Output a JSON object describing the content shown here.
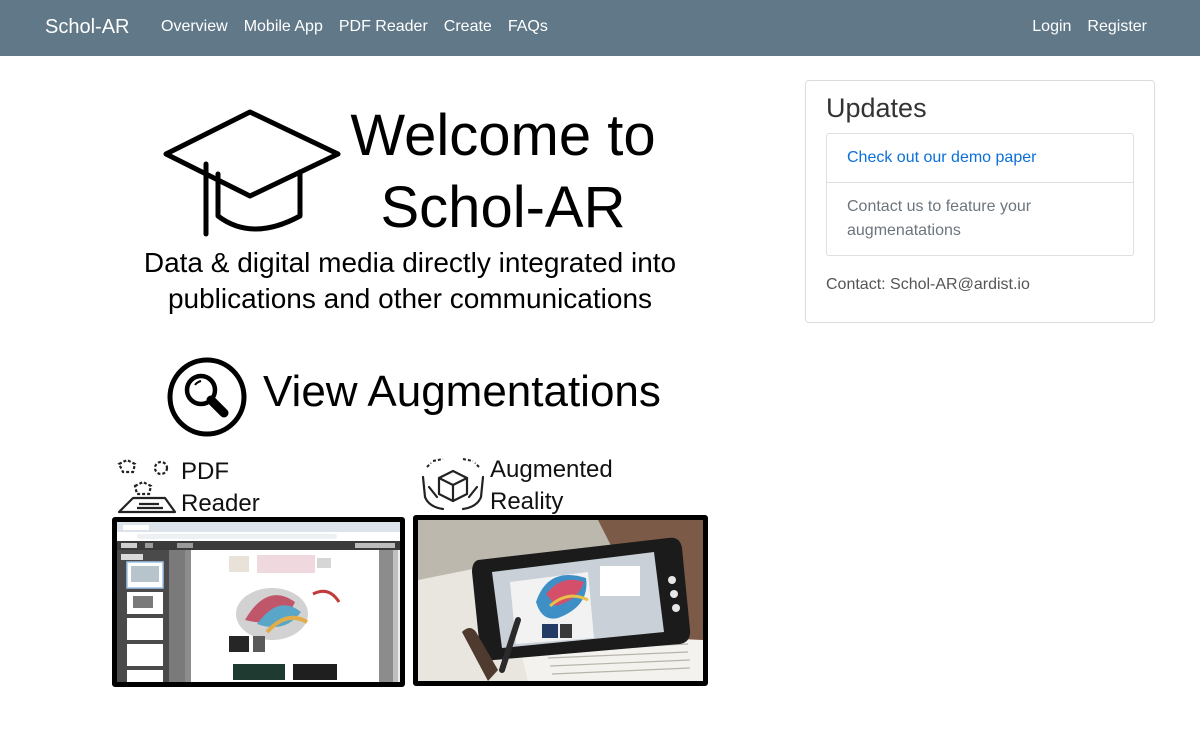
{
  "nav": {
    "brand": "Schol-AR",
    "links": [
      "Overview",
      "Mobile App",
      "PDF Reader",
      "Create",
      "FAQs"
    ],
    "right_links": [
      "Login",
      "Register"
    ]
  },
  "hero": {
    "welcome_line1": "Welcome to",
    "welcome_line2": "Schol-AR",
    "tagline_line1": "Data & digital media directly integrated into",
    "tagline_line2": "publications and other communications",
    "view_title": "View Augmentations"
  },
  "features": {
    "pdf": {
      "line1": "PDF",
      "line2": "Reader"
    },
    "ar": {
      "line1": "Augmented",
      "line2": "Reality"
    }
  },
  "updates": {
    "title": "Updates",
    "items": [
      "Check out our demo paper",
      "Contact us to feature your augmenatations"
    ],
    "contact": "Contact: Schol-AR@ardist.io"
  },
  "icons": {
    "brand_cap": "graduation-cap-icon",
    "view": "magnifying-glass-icon",
    "pdf": "pdf-reader-icon",
    "ar": "ar-hands-cube-icon"
  },
  "colors": {
    "navbar": "#607888",
    "link": "#0b6fd8",
    "muted": "#6c757d"
  }
}
